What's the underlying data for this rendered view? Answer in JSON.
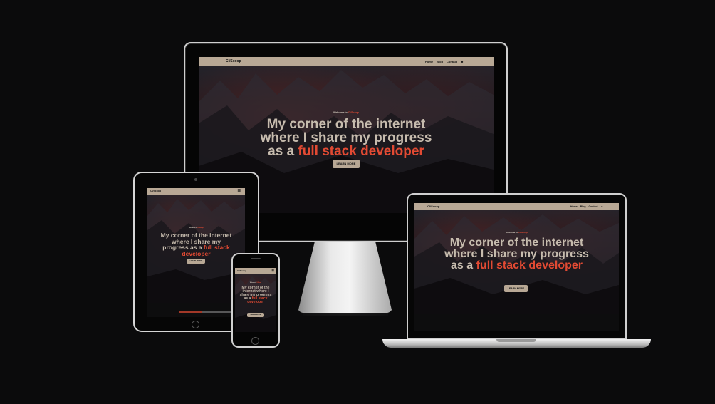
{
  "site": {
    "logo": "CI/Scoop",
    "logo_small": "Ci/Scoop",
    "nav_items": [
      "Home",
      "Blog",
      "Contact"
    ],
    "welcome_prefix": "Welcome to ",
    "welcome_name": "Ci/Scoop",
    "headline_main": "My corner of the internet where I share my progress as a ",
    "headline_accent": "full stack developer",
    "button_label": "LEARN MORE"
  },
  "colors": {
    "nav_bg": "#b8a895",
    "accent": "#e24a33",
    "headline": "#c7bcae",
    "page_bg": "#0b0b0c"
  },
  "icons": {
    "user": "user-icon",
    "menu": "hamburger-menu-icon"
  }
}
